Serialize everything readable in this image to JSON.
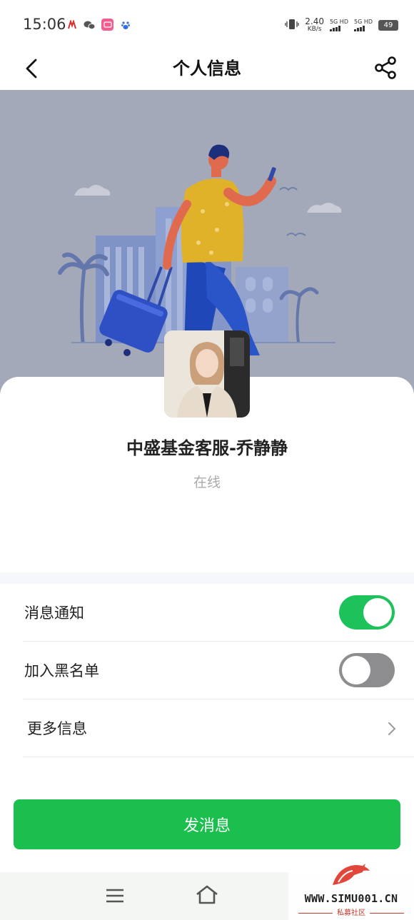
{
  "status_bar": {
    "time": "15:06",
    "net_speed_value": "2.40",
    "net_speed_unit": "KB/s",
    "sim1_label": "5G HD",
    "sim2_label": "5G HD",
    "battery": "49",
    "app_icons": [
      "app-icon-red",
      "wechat-icon",
      "bilibili-icon",
      "baidu-icon"
    ]
  },
  "header": {
    "title": "个人信息",
    "back_icon": "chevron-left-icon",
    "share_icon": "share-icon"
  },
  "profile": {
    "name": "中盛基金客服-乔静静",
    "status": "在线"
  },
  "settings": {
    "notifications": {
      "label": "消息通知",
      "enabled": true
    },
    "blacklist": {
      "label": "加入黑名单",
      "enabled": false
    },
    "more_info": {
      "label": "更多信息"
    }
  },
  "actions": {
    "send_message": "发消息"
  },
  "colors": {
    "accent_green": "#1bbf4e",
    "toggle_on": "#1ec25b",
    "toggle_off": "#8d8d8f",
    "hero_bg": "#a3a9b8"
  },
  "watermark": {
    "site": "WWW.SIMU001.CN",
    "caption": "私募社区"
  }
}
